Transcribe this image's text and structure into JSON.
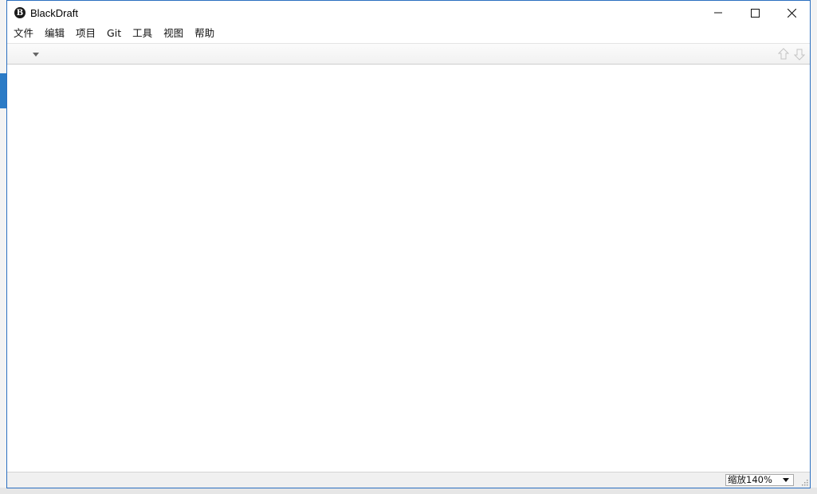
{
  "window": {
    "title": "BlackDraft",
    "app_icon_letter": "B"
  },
  "controls": {
    "minimize_icon": "minimize-icon",
    "maximize_icon": "maximize-icon",
    "close_icon": "close-icon"
  },
  "menu": {
    "items": [
      "文件",
      "编辑",
      "项目",
      "Git",
      "工具",
      "视图",
      "帮助"
    ]
  },
  "toolbar": {
    "dropdown_icon": "chevron-down-icon",
    "up_icon": "arrow-up-icon",
    "down_icon": "arrow-down-icon"
  },
  "status": {
    "zoom_label": "缩放140%"
  },
  "colors": {
    "window_border": "#2b6fc0",
    "toolbar_bg": "#f1f1f1",
    "status_bg": "#f0f0f0"
  }
}
